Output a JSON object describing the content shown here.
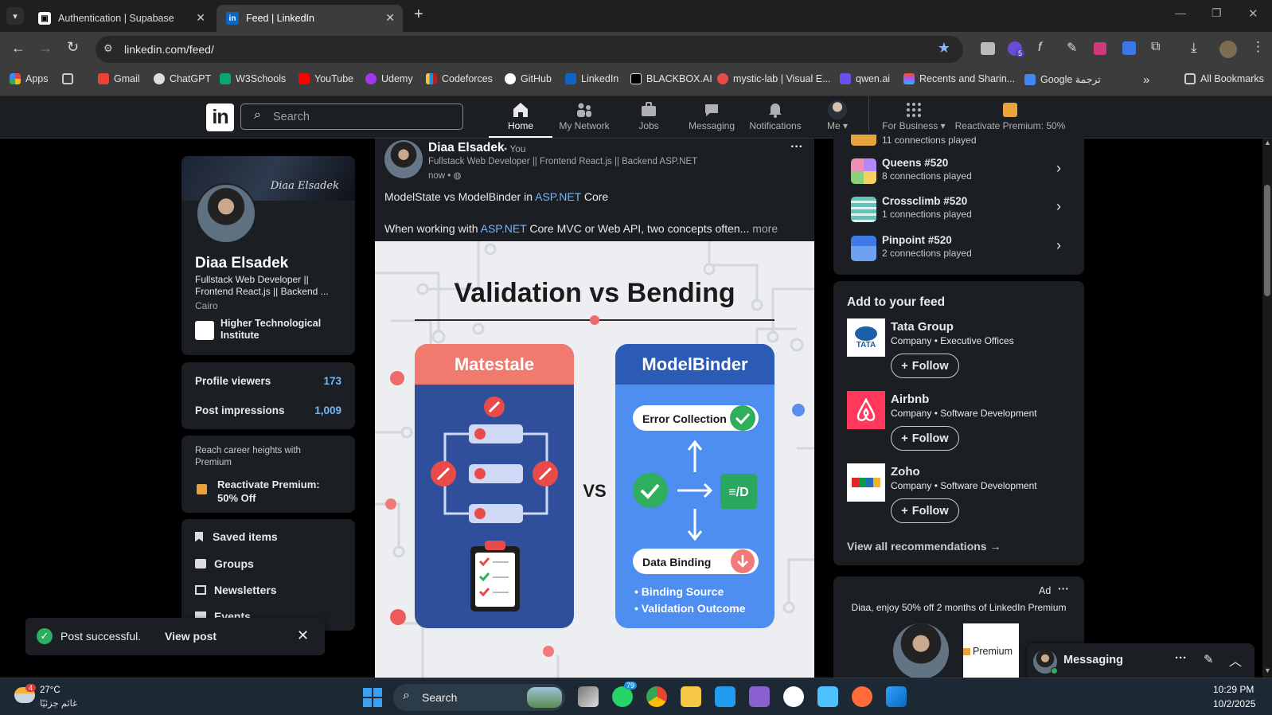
{
  "browser": {
    "tabs": [
      {
        "title": "Authentication | Supabase"
      },
      {
        "title": "Feed | LinkedIn"
      }
    ],
    "url": "linkedin.com/feed/",
    "extension_badge": "5",
    "bookmarks": [
      "Apps",
      "Gmail",
      "ChatGPT",
      "W3Schools",
      "YouTube",
      "Udemy",
      "Codeforces",
      "GitHub",
      "LinkedIn",
      "BLACKBOX.AI",
      "mystic-lab | Visual E...",
      "qwen.ai",
      "Recents and Sharin...",
      "Google ترجمة"
    ],
    "all_bookmarks": "All Bookmarks"
  },
  "linkedin_nav": {
    "logo": "in",
    "search_placeholder": "Search",
    "items": [
      {
        "label": "Home",
        "icon": "home-icon"
      },
      {
        "label": "My Network",
        "icon": "network-icon"
      },
      {
        "label": "Jobs",
        "icon": "briefcase-icon"
      },
      {
        "label": "Messaging",
        "icon": "message-icon"
      },
      {
        "label": "Notifications",
        "icon": "bell-icon"
      },
      {
        "label": "Me",
        "icon": "avatar"
      }
    ],
    "for_business": "For Business",
    "premium": "Reactivate Premium: 50% Off"
  },
  "profile": {
    "banner_text": "Diaa Elsadek",
    "name": "Diaa Elsadek",
    "headline": "Fullstack Web Developer || Frontend React.js || Backend ...",
    "location": "Cairo",
    "school": "Higher Technological Institute"
  },
  "stats": [
    {
      "label": "Profile viewers",
      "value": "173"
    },
    {
      "label": "Post impressions",
      "value": "1,009"
    }
  ],
  "premium_card": {
    "teaser": "Reach career heights with Premium",
    "cta": "Reactivate Premium: 50% Off"
  },
  "shortcuts": [
    "Saved items",
    "Groups",
    "Newsletters",
    "Events"
  ],
  "post": {
    "author": "Diaa Elsadek",
    "you": "• You",
    "headline": "Fullstack Web Developer || Frontend React.js || Backend ASP.NET",
    "time": "now •",
    "text_line1_a": "ModelState vs ModelBinder in ",
    "text_line1_link": "ASP.NET",
    "text_line1_b": " Core",
    "text_line2_a": "When working with ",
    "text_line2_link": "ASP.NET",
    "text_line2_b": " Core MVC or Web API, two concepts often...",
    "more": "more",
    "image": {
      "title": "Validation vs Bending",
      "left_label": "Matestale",
      "right_label": "ModelBinder",
      "vs": "VS",
      "error_collection": "Error Collection",
      "data_binding": "Data Binding",
      "doc_label": "≡/D",
      "bullets": [
        "Binding Source",
        "Validation Outcome"
      ]
    }
  },
  "toast": {
    "text": "Post successful.",
    "link": "View post"
  },
  "games": [
    {
      "name": "",
      "played": "11 connections played"
    },
    {
      "name": "Queens #520",
      "played": "8 connections played"
    },
    {
      "name": "Crossclimb #520",
      "played": "1 connections played"
    },
    {
      "name": "Pinpoint #520",
      "played": "2 connections played"
    }
  ],
  "feed_recs": {
    "title": "Add to your feed",
    "follow": "Follow",
    "items": [
      {
        "name": "Tata Group",
        "desc": "Company • Executive Offices",
        "logo": "TATA"
      },
      {
        "name": "Airbnb",
        "desc": "Company • Software Development",
        "logo": ""
      },
      {
        "name": "Zoho",
        "desc": "Company • Software Development",
        "logo": ""
      }
    ],
    "view_all": "View all recommendations →"
  },
  "ad": {
    "label": "Ad",
    "text": "Diaa, enjoy 50% off 2 months of LinkedIn Premium",
    "premium": "Premium"
  },
  "messaging": {
    "label": "Messaging"
  },
  "taskbar": {
    "weather_temp": "27°C",
    "weather_desc": "غائم جزئيًا",
    "weather_badge": "4",
    "search": "Search",
    "whatsapp_badge": "79",
    "time": "10:29 PM",
    "date": "10/2/2025"
  }
}
